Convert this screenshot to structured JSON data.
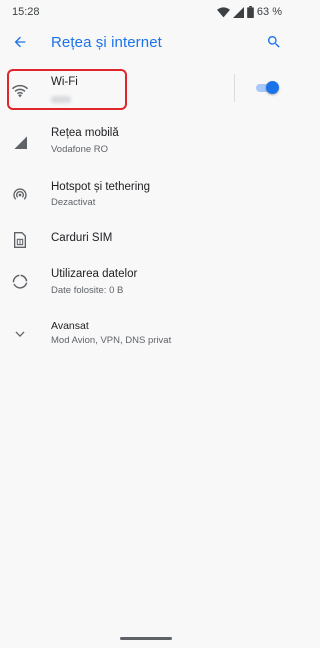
{
  "status_bar": {
    "time": "15:28",
    "battery_percent": "63 %"
  },
  "app_bar": {
    "title": "Rețea și internet"
  },
  "items": [
    {
      "label": "Wi-Fi",
      "summary": "",
      "toggle_on": true
    },
    {
      "label": "Rețea mobilă",
      "summary": "Vodafone RO"
    },
    {
      "label": "Hotspot și tethering",
      "summary": "Dezactivat"
    },
    {
      "label": "Carduri SIM",
      "summary": ""
    },
    {
      "label": "Utilizarea datelor",
      "summary": "Date folosite: 0 B"
    },
    {
      "label": "Avansat",
      "summary": "Mod Avion, VPN, DNS privat"
    }
  ],
  "colors": {
    "accent": "#1a73e8",
    "highlight": "#e0262a",
    "background": "#f8f8f8"
  }
}
